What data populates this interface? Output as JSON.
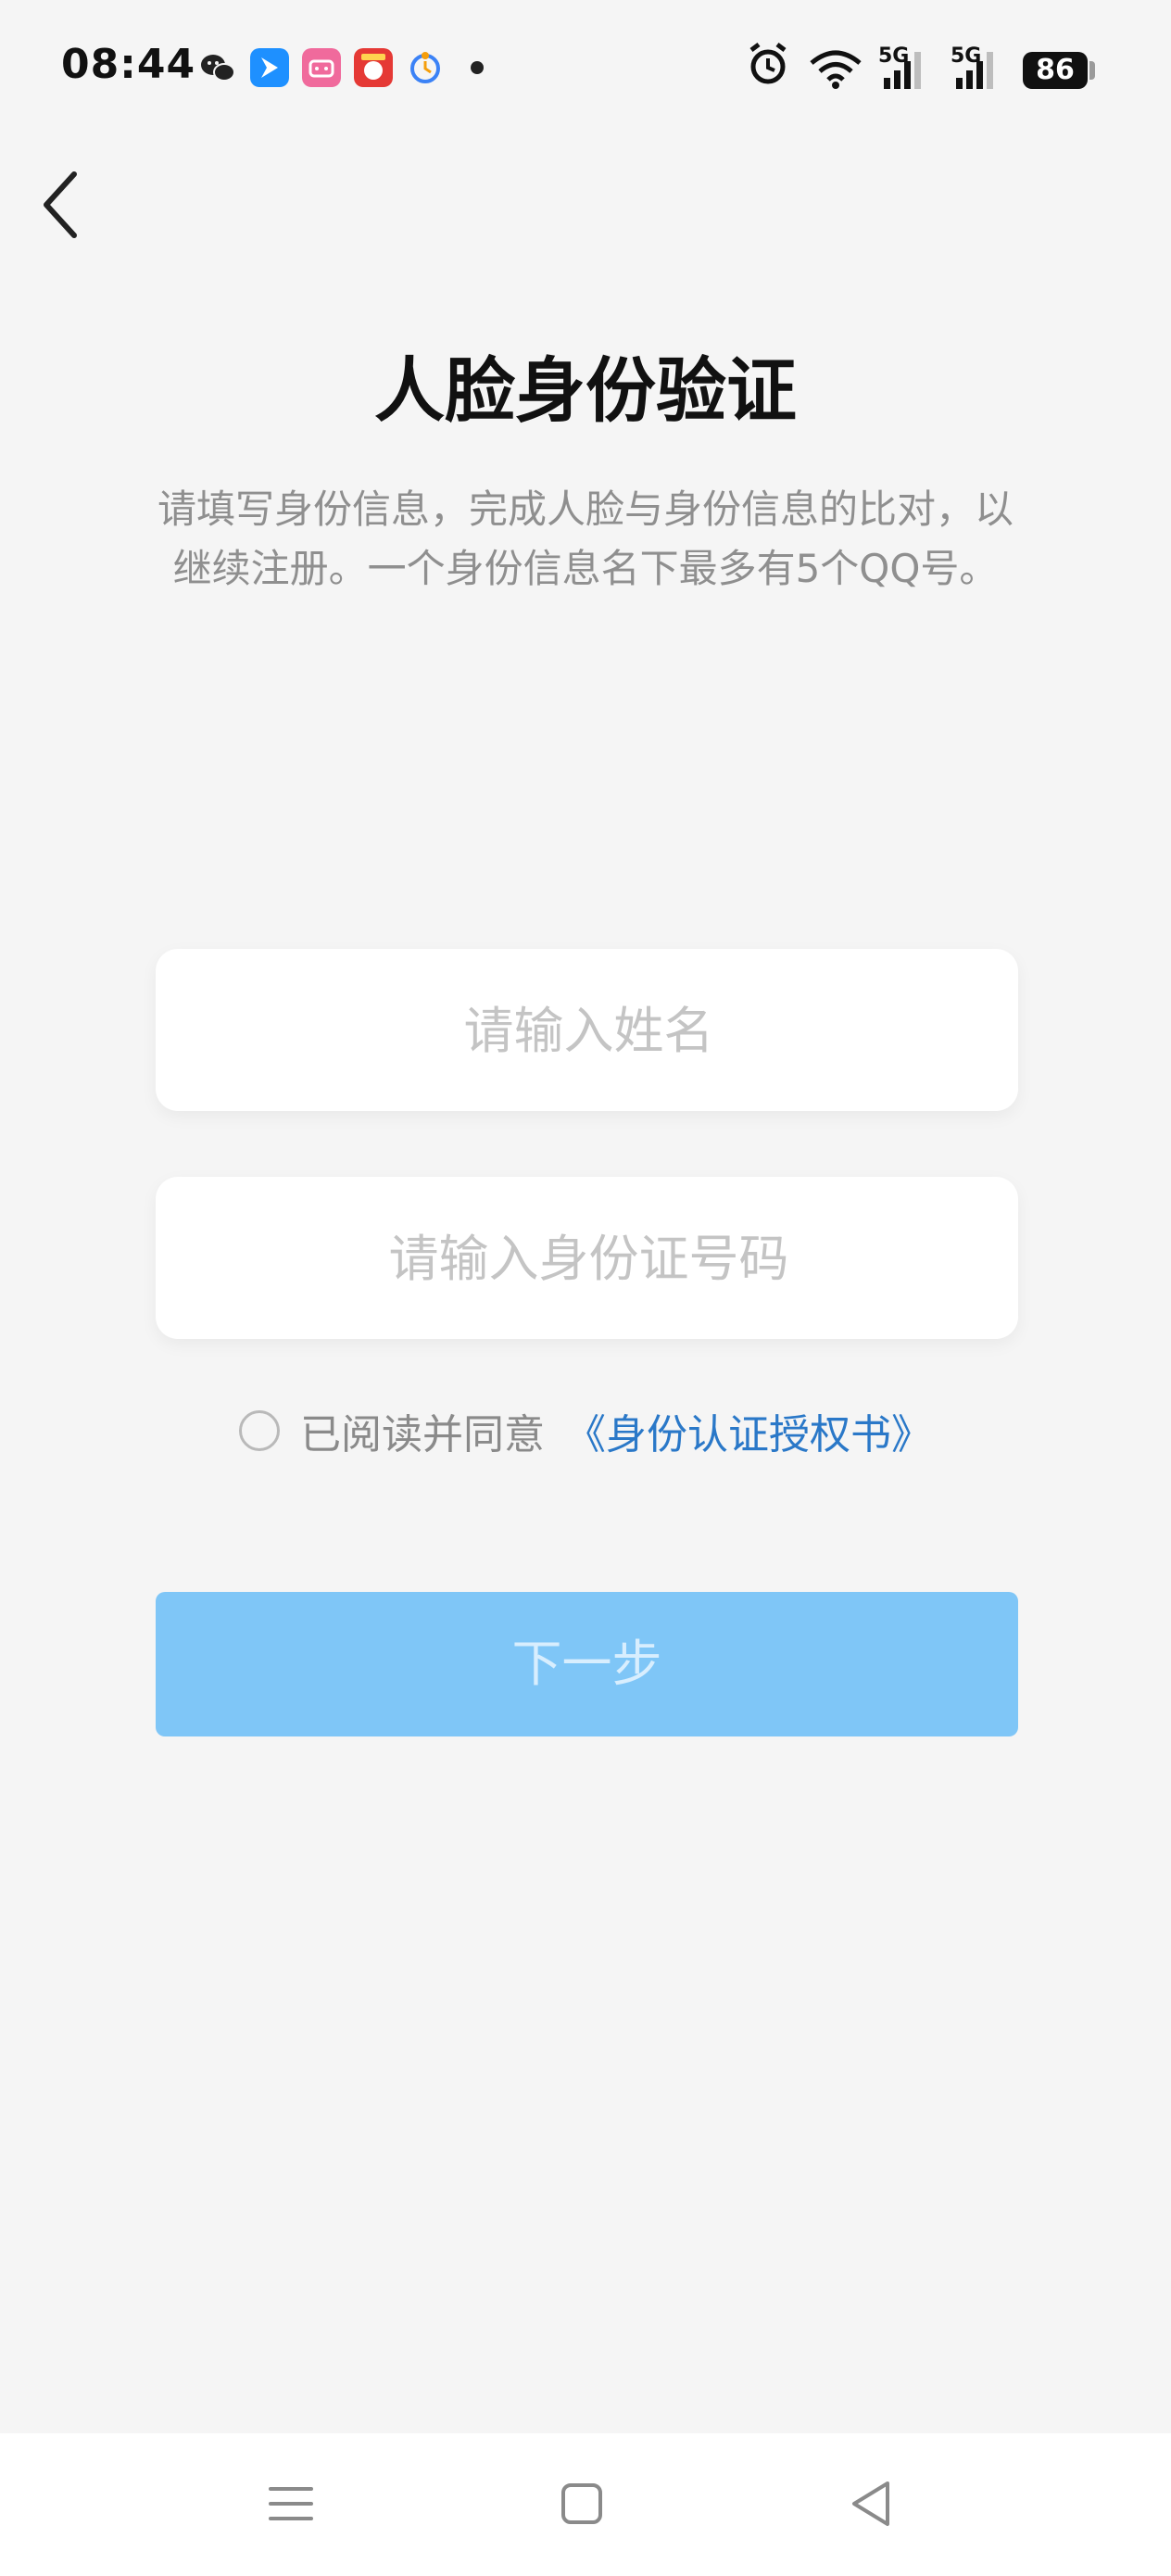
{
  "status_bar": {
    "time": "08:44",
    "battery": "86",
    "network_1": "5G",
    "network_2": "5G",
    "colors": {
      "wechat": "#222222",
      "feishu": "#1e90ff",
      "bilibili": "#f06a9c",
      "game": "#e53935",
      "clock_app": "#3b82f6"
    }
  },
  "header": {
    "back_icon": "chevron-left-icon"
  },
  "main": {
    "title": "人脸身份验证",
    "description": "请填写身份信息，完成人脸与身份信息的比对，以继续注册。一个身份信息名下最多有5个QQ号。",
    "name_input": {
      "value": "",
      "placeholder": "请输入姓名"
    },
    "id_input": {
      "value": "",
      "placeholder": "请输入身份证号码"
    },
    "agreement": {
      "checked": false,
      "label": "已阅读并同意",
      "link": "《身份认证授权书》"
    },
    "next_button": "下一步"
  },
  "colors": {
    "background": "#f5f5f5",
    "primary_button_disabled": "#7fc6f7",
    "link": "#2a78c8"
  },
  "nav_bar": {
    "menu_icon": "menu-icon",
    "home_icon": "home-square-icon",
    "back_icon": "triangle-back-icon"
  }
}
